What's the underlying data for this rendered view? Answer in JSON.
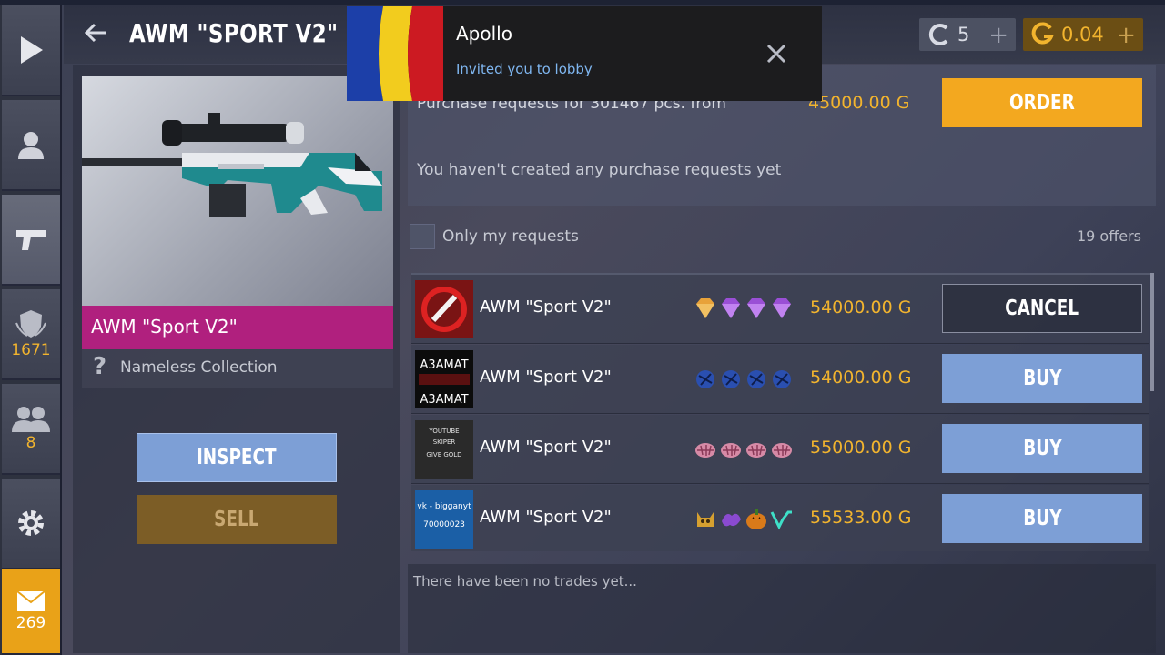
{
  "header": {
    "title": "AWM \"SPORT V2\"",
    "coins": "5",
    "gold": "0.04"
  },
  "rail": {
    "rank_value": "1671",
    "friends_value": "8",
    "mail_value": "269"
  },
  "item": {
    "name": "AWM \"Sport V2\"",
    "collection": "Nameless Collection",
    "inspect_label": "INSPECT",
    "sell_label": "SELL"
  },
  "order": {
    "text": "Purchase requests for 301467 pcs. from",
    "price": "45000.00 G",
    "button_label": "ORDER",
    "no_requests": "You haven't created any purchase requests yet"
  },
  "filter": {
    "label": "Only my requests",
    "offers_count": "19 offers"
  },
  "offers": [
    {
      "name": "AWM \"Sport V2\"",
      "price": "54000.00 G",
      "action": "CANCEL"
    },
    {
      "name": "AWM \"Sport V2\"",
      "price": "54000.00 G",
      "action": "BUY",
      "avatar_line1": "A3AMAT",
      "avatar_line2": "A3AMAT"
    },
    {
      "name": "AWM \"Sport V2\"",
      "price": "55000.00 G",
      "action": "BUY",
      "avatar_line1": "YOUTUBE",
      "avatar_line2": "SKIPER",
      "avatar_line3": "GIVE GOLD"
    },
    {
      "name": "AWM \"Sport V2\"",
      "price": "55533.00 G",
      "action": "BUY",
      "avatar_line1": "vk - bigganyt",
      "avatar_line2": "70000023"
    }
  ],
  "trades": {
    "empty_text": "There have been no trades yet..."
  },
  "notification": {
    "user": "Apollo",
    "message": "Invited you to lobby"
  },
  "colors": {
    "accent_gold": "#f2b42e",
    "rarity_magenta": "#b0207e",
    "buy_blue": "#7d9fd6",
    "order_orange": "#f3a81f"
  }
}
